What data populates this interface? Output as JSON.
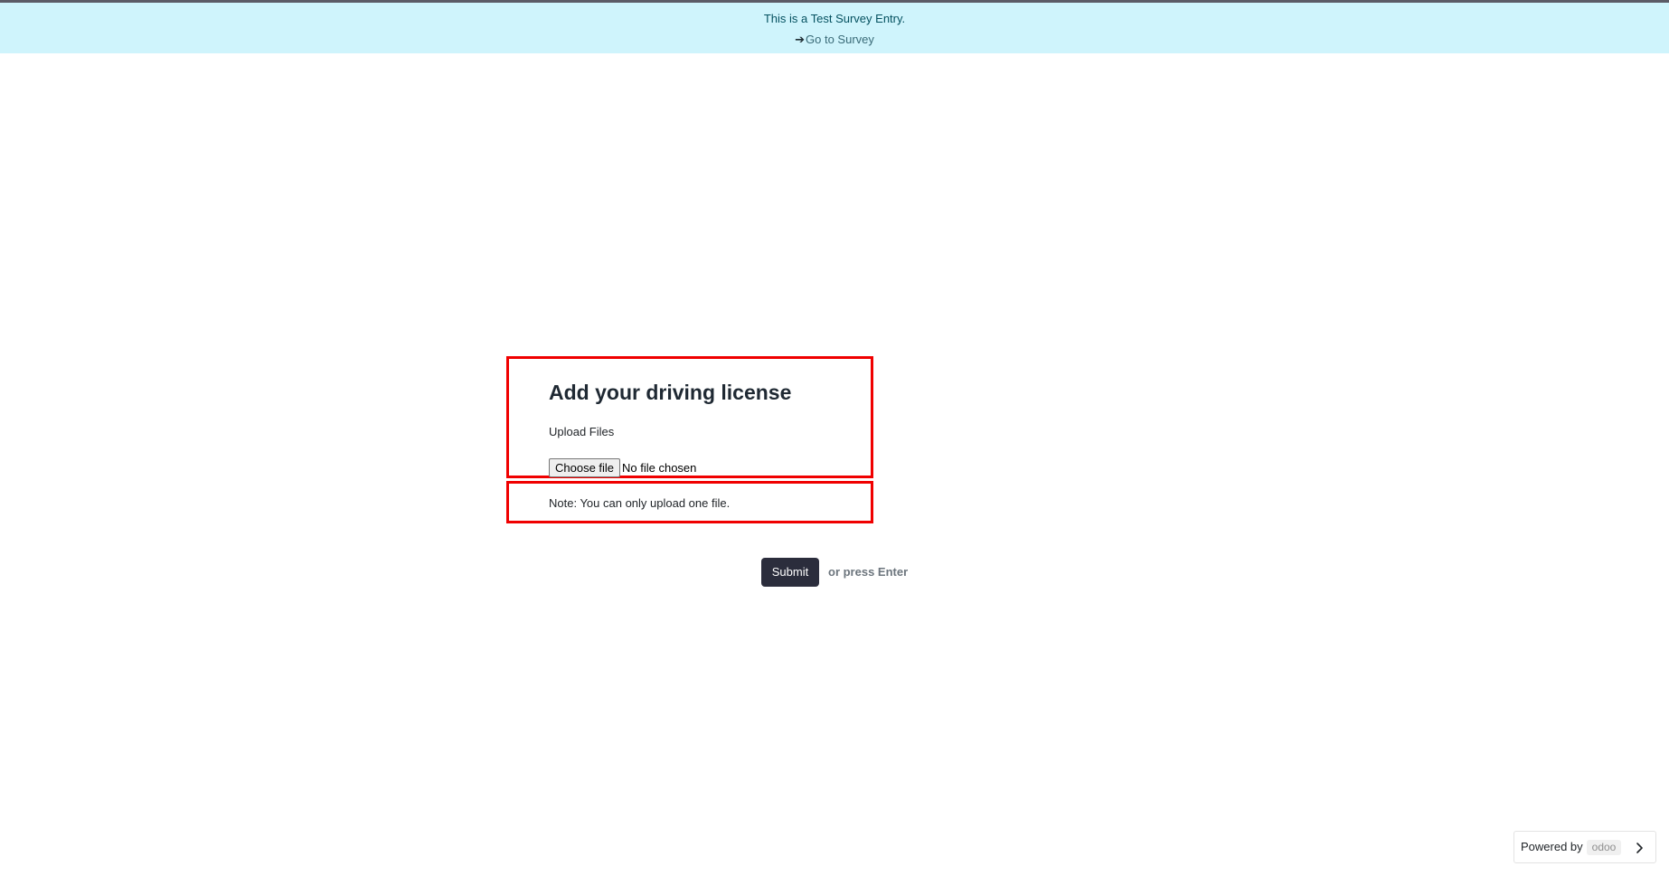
{
  "banner": {
    "text": "This is a Test Survey Entry.",
    "arrow_icon": "➔",
    "link_label": "Go to Survey"
  },
  "question": {
    "title": "Add your driving license",
    "description": "Upload Files",
    "file_input": {
      "button_label": "Choose file",
      "status": "No file chosen"
    },
    "note": "Note: You can only upload one file."
  },
  "actions": {
    "submit_label": "Submit",
    "hint": "or press Enter"
  },
  "footer": {
    "powered_by": "Powered by",
    "logo_text": "odoo",
    "chevron_icon": "chevron-right-icon"
  },
  "colors": {
    "banner_bg": "#cff4fc",
    "highlight_border": "#f00000",
    "submit_bg": "#2b2d3c"
  }
}
